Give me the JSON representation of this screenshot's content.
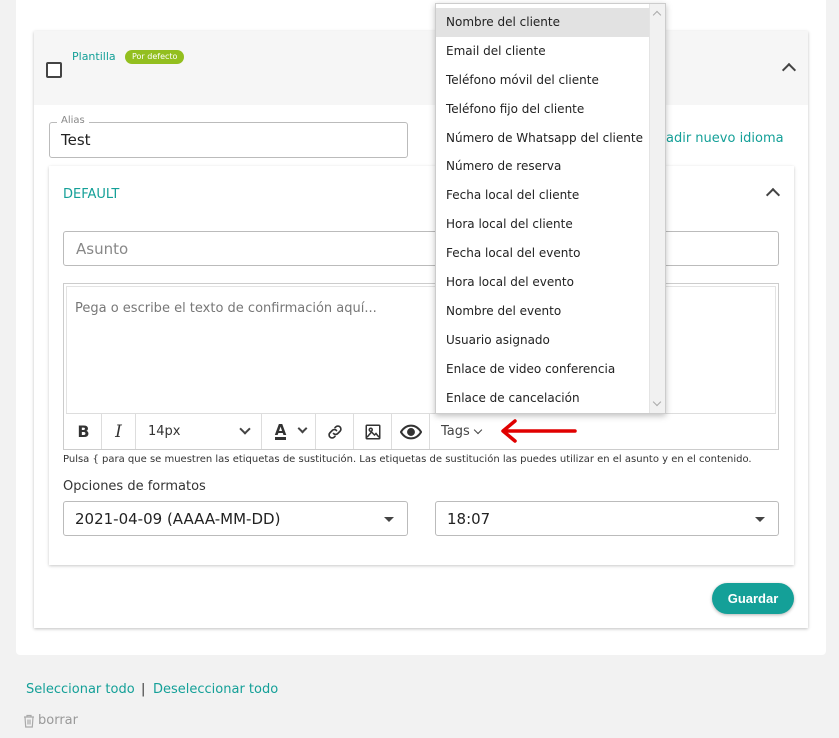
{
  "template": {
    "label": "Plantilla",
    "badge": "Por defecto"
  },
  "alias": {
    "legend": "Alias",
    "value": "Test"
  },
  "add_language": "adir nuevo idioma",
  "section": {
    "title": "DEFAULT"
  },
  "subject": {
    "placeholder": "Asunto"
  },
  "editor": {
    "placeholder": "Pega o escribe el texto de confirmación aquí...",
    "font_size": "14px",
    "tags_label": "Tags"
  },
  "hint": "Pulsa { para que se muestren las etiquetas de sustitución. Las etiquetas de sustitución las puedes utilizar en el asunto y en el contenido.",
  "formats": {
    "label": "Opciones de formatos",
    "date_value": "2021-04-09 (AAAA-MM-DD)",
    "time_value": "18:07"
  },
  "save_label": "Guardar",
  "footer": {
    "select_all": "Seleccionar todo",
    "separator": "|",
    "deselect_all": "Deseleccionar todo",
    "delete": "borrar"
  },
  "tags_dropdown": {
    "items": [
      "Nombre del cliente",
      "Email del cliente",
      "Teléfono móvil del cliente",
      "Teléfono fijo del cliente",
      "Número de Whatsapp del cliente",
      "Número de reserva",
      "Fecha local del cliente",
      "Hora local del cliente",
      "Fecha local del evento",
      "Hora local del evento",
      "Nombre del evento",
      "Usuario asignado",
      "Enlace de video conferencia",
      "Enlace de cancelación"
    ],
    "highlighted_index": 0
  },
  "colors": {
    "accent": "#14a098",
    "badge": "#93bf1f",
    "arrow": "#e00000"
  }
}
